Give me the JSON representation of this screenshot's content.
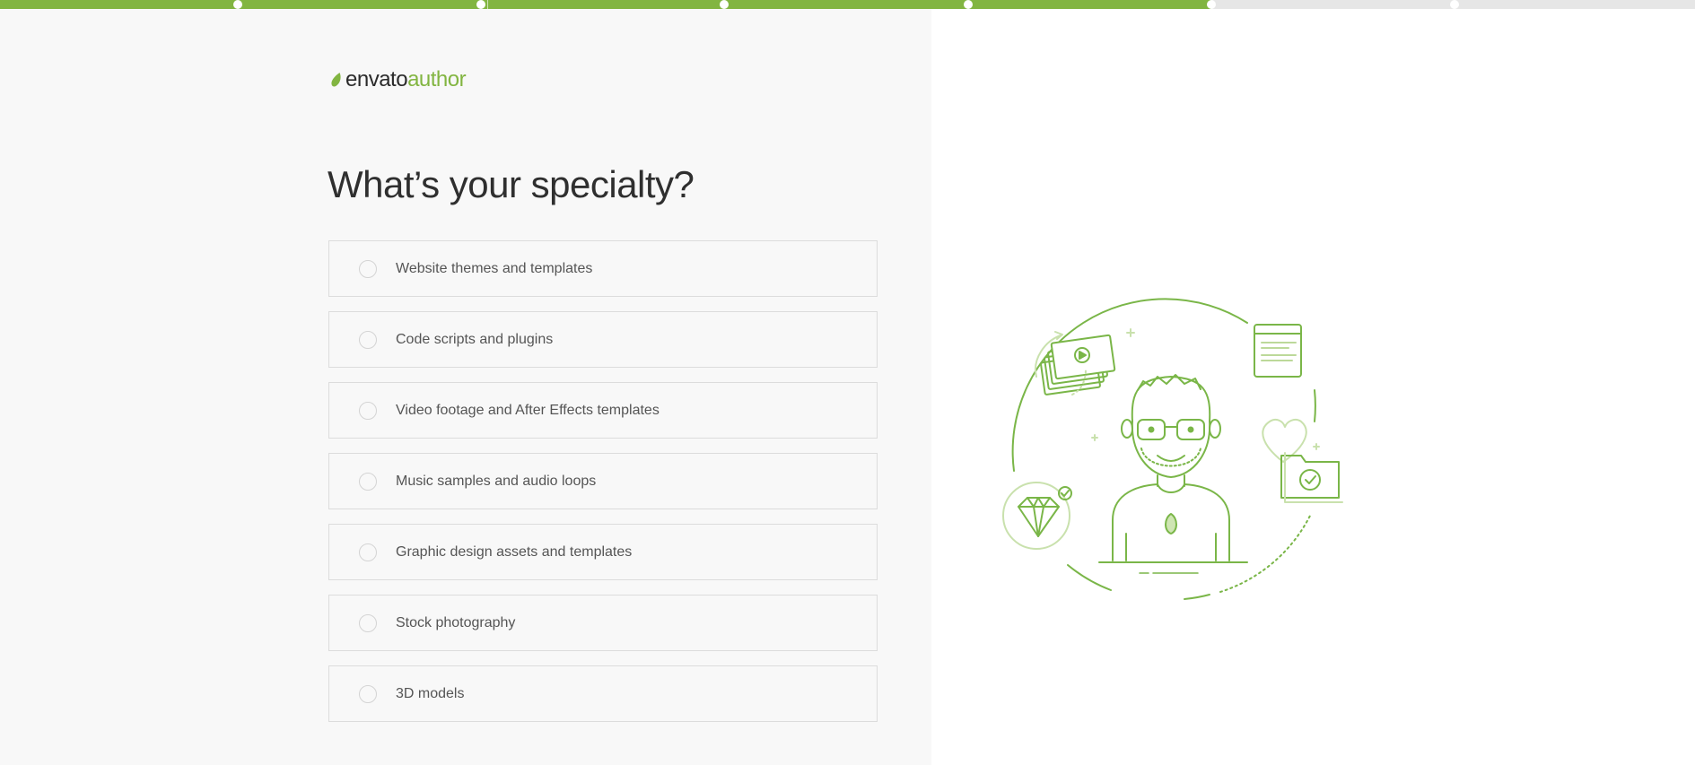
{
  "progress": {
    "steps_total": 6,
    "steps_completed": 5,
    "colors": {
      "fill": "#82b541",
      "track": "#e6e6e6"
    }
  },
  "brand": {
    "name": "envato",
    "product": "author",
    "accent": "#82b541",
    "icon": "leaf-icon"
  },
  "page": {
    "title": "What’s your specialty?"
  },
  "options": [
    {
      "label": "Website themes and templates",
      "selected": false
    },
    {
      "label": "Code scripts and plugins",
      "selected": false
    },
    {
      "label": "Video footage and After Effects templates",
      "selected": false
    },
    {
      "label": "Music samples and audio loops",
      "selected": false
    },
    {
      "label": "Graphic design assets and templates",
      "selected": false
    },
    {
      "label": "Stock photography",
      "selected": false
    },
    {
      "label": "3D models",
      "selected": false
    }
  ],
  "illustration": {
    "icon": "author-illustration",
    "color": "#7ab648"
  }
}
